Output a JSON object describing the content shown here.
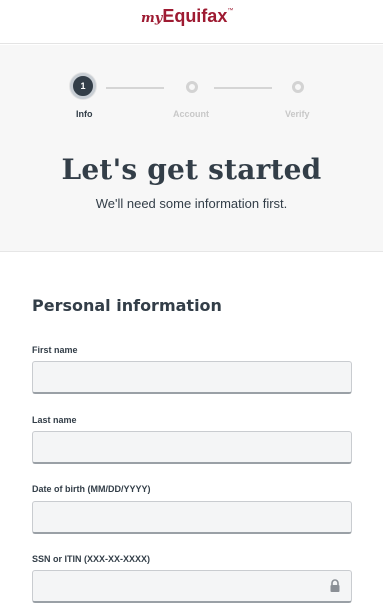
{
  "header": {
    "logo_my": "my",
    "logo_brand": "Equifax",
    "logo_tm": "™"
  },
  "stepper": {
    "steps": [
      {
        "number": "1",
        "label": "Info",
        "active": true
      },
      {
        "number": "",
        "label": "Account",
        "active": false
      },
      {
        "number": "",
        "label": "Verify",
        "active": false
      }
    ]
  },
  "hero": {
    "title": "Let's get started",
    "subtitle": "We'll need some information first."
  },
  "form": {
    "section_title": "Personal information",
    "fields": [
      {
        "label": "First name",
        "value": ""
      },
      {
        "label": "Last name",
        "value": ""
      },
      {
        "label": "Date of birth (MM/DD/YYYY)",
        "value": ""
      },
      {
        "label": "SSN or ITIN (XXX-XX-XXXX)",
        "value": ""
      }
    ]
  },
  "icons": {
    "ssn_secure": "lock-icon"
  },
  "colors": {
    "brand": "#9e1b32",
    "primary_text": "#333e48",
    "hero_background": "#f7f7f7",
    "input_background": "#f4f5f6"
  }
}
